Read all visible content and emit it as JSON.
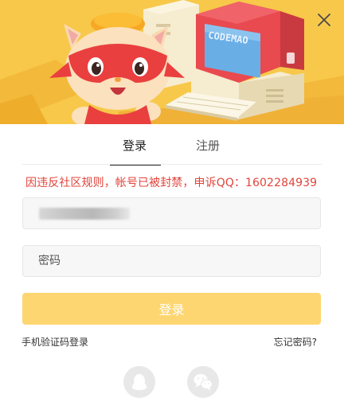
{
  "banner": {
    "computer_screen_text": "CODEMAO"
  },
  "tabs": [
    {
      "label": "登录",
      "active": true
    },
    {
      "label": "注册",
      "active": false
    }
  ],
  "error_message": "因违反社区规则，帐号已被封禁，申诉QQ：1602284939",
  "account_field": {
    "value": "",
    "value_blurred": true
  },
  "password_field": {
    "placeholder": "密码"
  },
  "submit_button": {
    "label": "登录"
  },
  "links": {
    "sms_login": "手机验证码登录",
    "forgot_password": "忘记密码?"
  },
  "social_login": [
    {
      "icon": "qq-icon"
    },
    {
      "icon": "wechat-icon"
    }
  ],
  "colors": {
    "banner_bg": "#f7c84a",
    "error": "#e2443b",
    "submit_bg": "#fed671",
    "field_bg": "#f7f7f7",
    "social_bg": "#e8e8e8"
  }
}
